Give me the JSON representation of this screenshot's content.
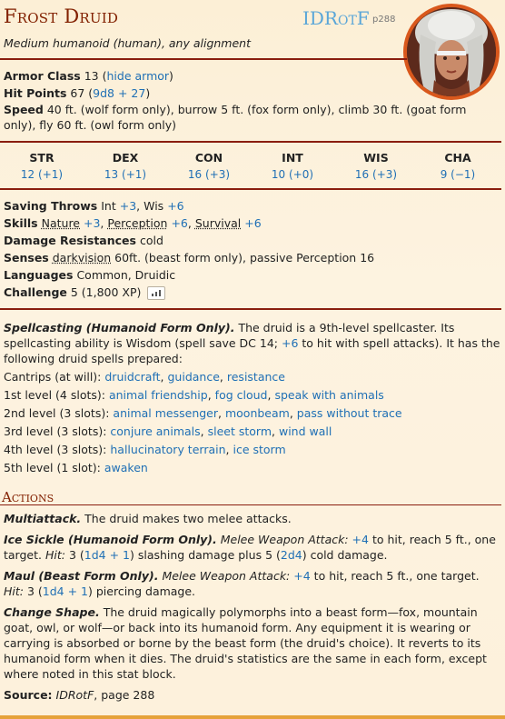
{
  "header": {
    "name": "Frost Druid",
    "source_tag": "IDRotF",
    "source_page": "p288",
    "meta": "Medium humanoid (human), any alignment"
  },
  "avatar": {
    "icon": "portrait-image",
    "border_color": "#d9581c"
  },
  "stats": {
    "ac_label": "Armor Class",
    "ac_value": "13",
    "ac_detail": "hide armor",
    "hp_label": "Hit Points",
    "hp_value": "67",
    "hp_dice": "9d8 + 27",
    "speed_label": "Speed",
    "speed_text": "40 ft. (wolf form only), burrow 5 ft. (fox form only), climb 30 ft. (goat form only), fly 60 ft. (owl form only)"
  },
  "abilities": [
    {
      "name": "STR",
      "value": "12 (+1)"
    },
    {
      "name": "DEX",
      "value": "13 (+1)"
    },
    {
      "name": "CON",
      "value": "16 (+3)"
    },
    {
      "name": "INT",
      "value": "10 (+0)"
    },
    {
      "name": "WIS",
      "value": "16 (+3)"
    },
    {
      "name": "CHA",
      "value": "9 (−1)"
    }
  ],
  "traits": {
    "saves_label": "Saving Throws",
    "saves_int": "Int",
    "saves_int_val": "+3",
    "saves_wis": ", Wis",
    "saves_wis_val": "+6",
    "skills_label": "Skills",
    "skill_1": "Nature",
    "skill_1_val": "+3",
    "skill_2": "Perception",
    "skill_2_val": "+6",
    "skill_3": "Survival",
    "skill_3_val": "+6",
    "resist_label": "Damage Resistances",
    "resist_value": "cold",
    "senses_label": "Senses",
    "senses_dark": "darkvision",
    "senses_rest": "60ft. (beast form only), passive Perception 16",
    "lang_label": "Languages",
    "lang_value": "Common, Druidic",
    "cr_label": "Challenge",
    "cr_value": "5 (1,800 XP)"
  },
  "spellcasting": {
    "title": "Spellcasting (Humanoid Form Only).",
    "intro_1": "The druid is a 9th-level spellcaster. Its spellcasting ability is Wisdom (spell save DC 14;",
    "intro_bonus": "+6",
    "intro_2": "to hit with spell attacks). It has the following druid spells prepared:",
    "levels": [
      {
        "label": "Cantrips (at will):",
        "spells": [
          "druidcraft",
          "guidance",
          "resistance"
        ]
      },
      {
        "label": "1st level (4 slots):",
        "spells": [
          "animal friendship",
          "fog cloud",
          "speak with animals"
        ]
      },
      {
        "label": "2nd level (3 slots):",
        "spells": [
          "animal messenger",
          "moonbeam",
          "pass without trace"
        ]
      },
      {
        "label": "3rd level (3 slots):",
        "spells": [
          "conjure animals",
          "sleet storm",
          "wind wall"
        ]
      },
      {
        "label": "4th level (3 slots):",
        "spells": [
          "hallucinatory terrain",
          "ice storm"
        ]
      },
      {
        "label": "5th level (1 slot):",
        "spells": [
          "awaken"
        ]
      }
    ]
  },
  "actions": {
    "heading": "Actions",
    "multi_title": "Multiattack.",
    "multi_text": "The druid makes two melee attacks.",
    "sickle_title": "Ice Sickle (Humanoid Form Only).",
    "sickle_type": "Melee Weapon Attack:",
    "sickle_bonus": "+4",
    "sickle_reach": "to hit, reach 5 ft., one target.",
    "hit_label": "Hit:",
    "sickle_dmg1": "3 (",
    "sickle_dice1": "1d4 + 1",
    "sickle_dmg2": ") slashing damage plus 5 (",
    "sickle_dice2": "2d4",
    "sickle_dmg3": ") cold damage.",
    "maul_title": "Maul (Beast Form Only).",
    "maul_type": "Melee Weapon Attack:",
    "maul_bonus": "+4",
    "maul_reach": "to hit, reach 5 ft., one target.",
    "maul_dmg1": "3 (",
    "maul_dice": "1d4 + 1",
    "maul_dmg2": ") piercing damage.",
    "shape_title": "Change Shape.",
    "shape_text": "The druid magically polymorphs into a beast form—fox, mountain goat, owl, or wolf—or back into its humanoid form. Any equipment it is wearing or carrying is absorbed or borne by the beast form (the druid's choice). It reverts to its humanoid form when it dies. The druid's statistics are the same in each form, except where noted in this stat block."
  },
  "footer": {
    "source_label": "Source:",
    "source_book": "IDRotF",
    "source_page": ", page 288"
  },
  "colors": {
    "accent": "#822000",
    "link": "#1f6fb5",
    "rule": "#8a1e0f",
    "bottom_bar": "#e6a23a"
  }
}
